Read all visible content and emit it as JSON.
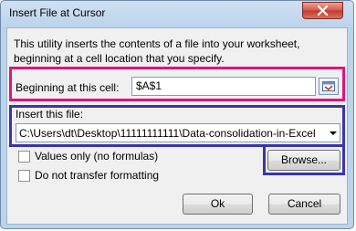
{
  "window": {
    "title": "Insert File at Cursor"
  },
  "description": "This utility inserts the contents of a file into your worksheet, beginning at a cell location that you specify.",
  "cell": {
    "label": "Beginning at this cell:",
    "value": "$A$1"
  },
  "file": {
    "label": "Insert this file:",
    "value": "C:\\Users\\dt\\Desktop\\11111111111\\Data-consolidation-in-Excel"
  },
  "options": [
    {
      "label": "Values only (no formulas)",
      "checked": false
    },
    {
      "label": "Do not transfer formatting",
      "checked": false
    }
  ],
  "buttons": {
    "browse": "Browse...",
    "ok": "Ok",
    "cancel": "Cancel"
  },
  "colors": {
    "highlight_pink": "#e0157a",
    "highlight_blue": "#3b35a8",
    "close": "#c7443a"
  }
}
